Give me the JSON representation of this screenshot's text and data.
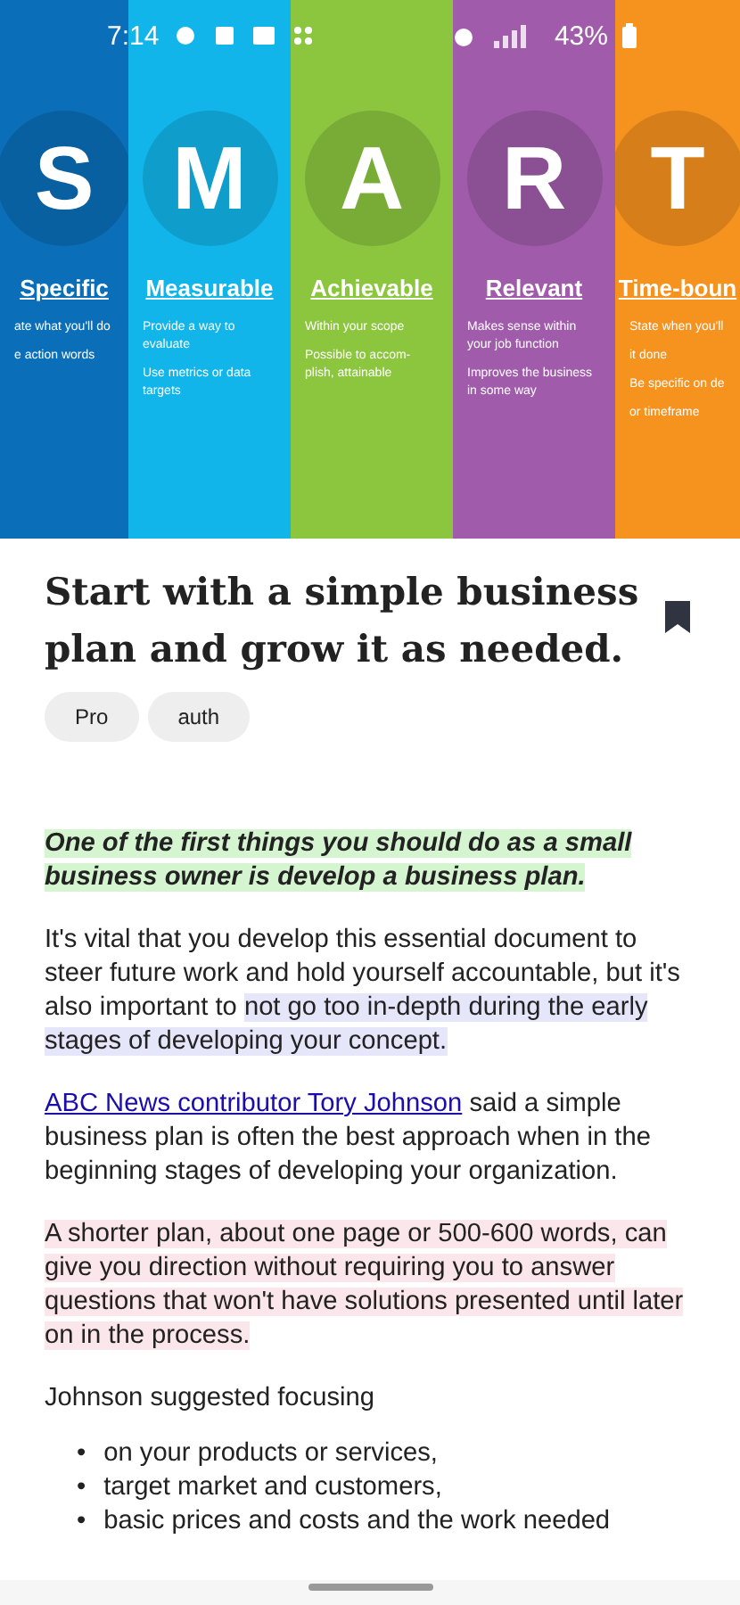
{
  "status_bar": {
    "time": "7:14",
    "battery": "43%"
  },
  "hero": {
    "columns": [
      {
        "letter": "S",
        "title": "Specific",
        "color": "#0a6fb8",
        "lines": [
          "ate what you'll do",
          "e action words"
        ]
      },
      {
        "letter": "M",
        "title": "Measurable",
        "color": "#12b5ea",
        "lines": [
          "Provide a way to evaluate",
          "Use metrics or data targets"
        ]
      },
      {
        "letter": "A",
        "title": "Achievable",
        "color": "#8cc63f",
        "lines": [
          "Within your scope",
          "Possible to accom-plish, attainable"
        ]
      },
      {
        "letter": "R",
        "title": "Relevant",
        "color": "#a05bab",
        "lines": [
          "Makes sense within your job function",
          "Improves the business in some way"
        ]
      },
      {
        "letter": "T",
        "title": "Time-boun",
        "color": "#f6921e",
        "lines": [
          "State when you'll",
          "it done",
          "Be specific on de",
          "or timeframe"
        ]
      }
    ]
  },
  "article": {
    "title": "Start with a simple business plan and grow it as needed.",
    "bookmarked": true,
    "tags": [
      "Pro",
      "auth"
    ],
    "paragraphs": [
      [
        {
          "kind": "highlight",
          "color": "#d5f5d0",
          "text": "One of the first things you should do as a small business owner is develop a business plan.",
          "emphasis": true
        }
      ],
      [
        {
          "kind": "plain",
          "text": "It's vital that you develop this essential document to steer future work and hold yourself accountable, but it's also important to "
        },
        {
          "kind": "highlight",
          "color": "#e6e6fa",
          "text": "not go too in-depth during the early stages of developing your concept."
        }
      ],
      [
        {
          "kind": "link",
          "text": "ABC News contributor Tory Johnson"
        },
        {
          "kind": "plain",
          "text": " said a simple business plan is often the best approach when in the beginning stages of developing your organization."
        }
      ],
      [
        {
          "kind": "highlight",
          "color": "#fbe6ec",
          "text": "A shorter plan, about one page or 500-600 words, can give you direction without requiring you to answer questions that won't have solutions presented until later on in the process."
        }
      ],
      [
        {
          "kind": "plain",
          "text": "Johnson suggested focusing"
        }
      ]
    ],
    "bullets": [
      {
        "marker": "•",
        "text": "on your products or services,"
      },
      {
        "marker": "•",
        "text": "target market and customers,"
      },
      {
        "marker": "•",
        "text": "basic prices and costs and the work needed"
      }
    ]
  }
}
